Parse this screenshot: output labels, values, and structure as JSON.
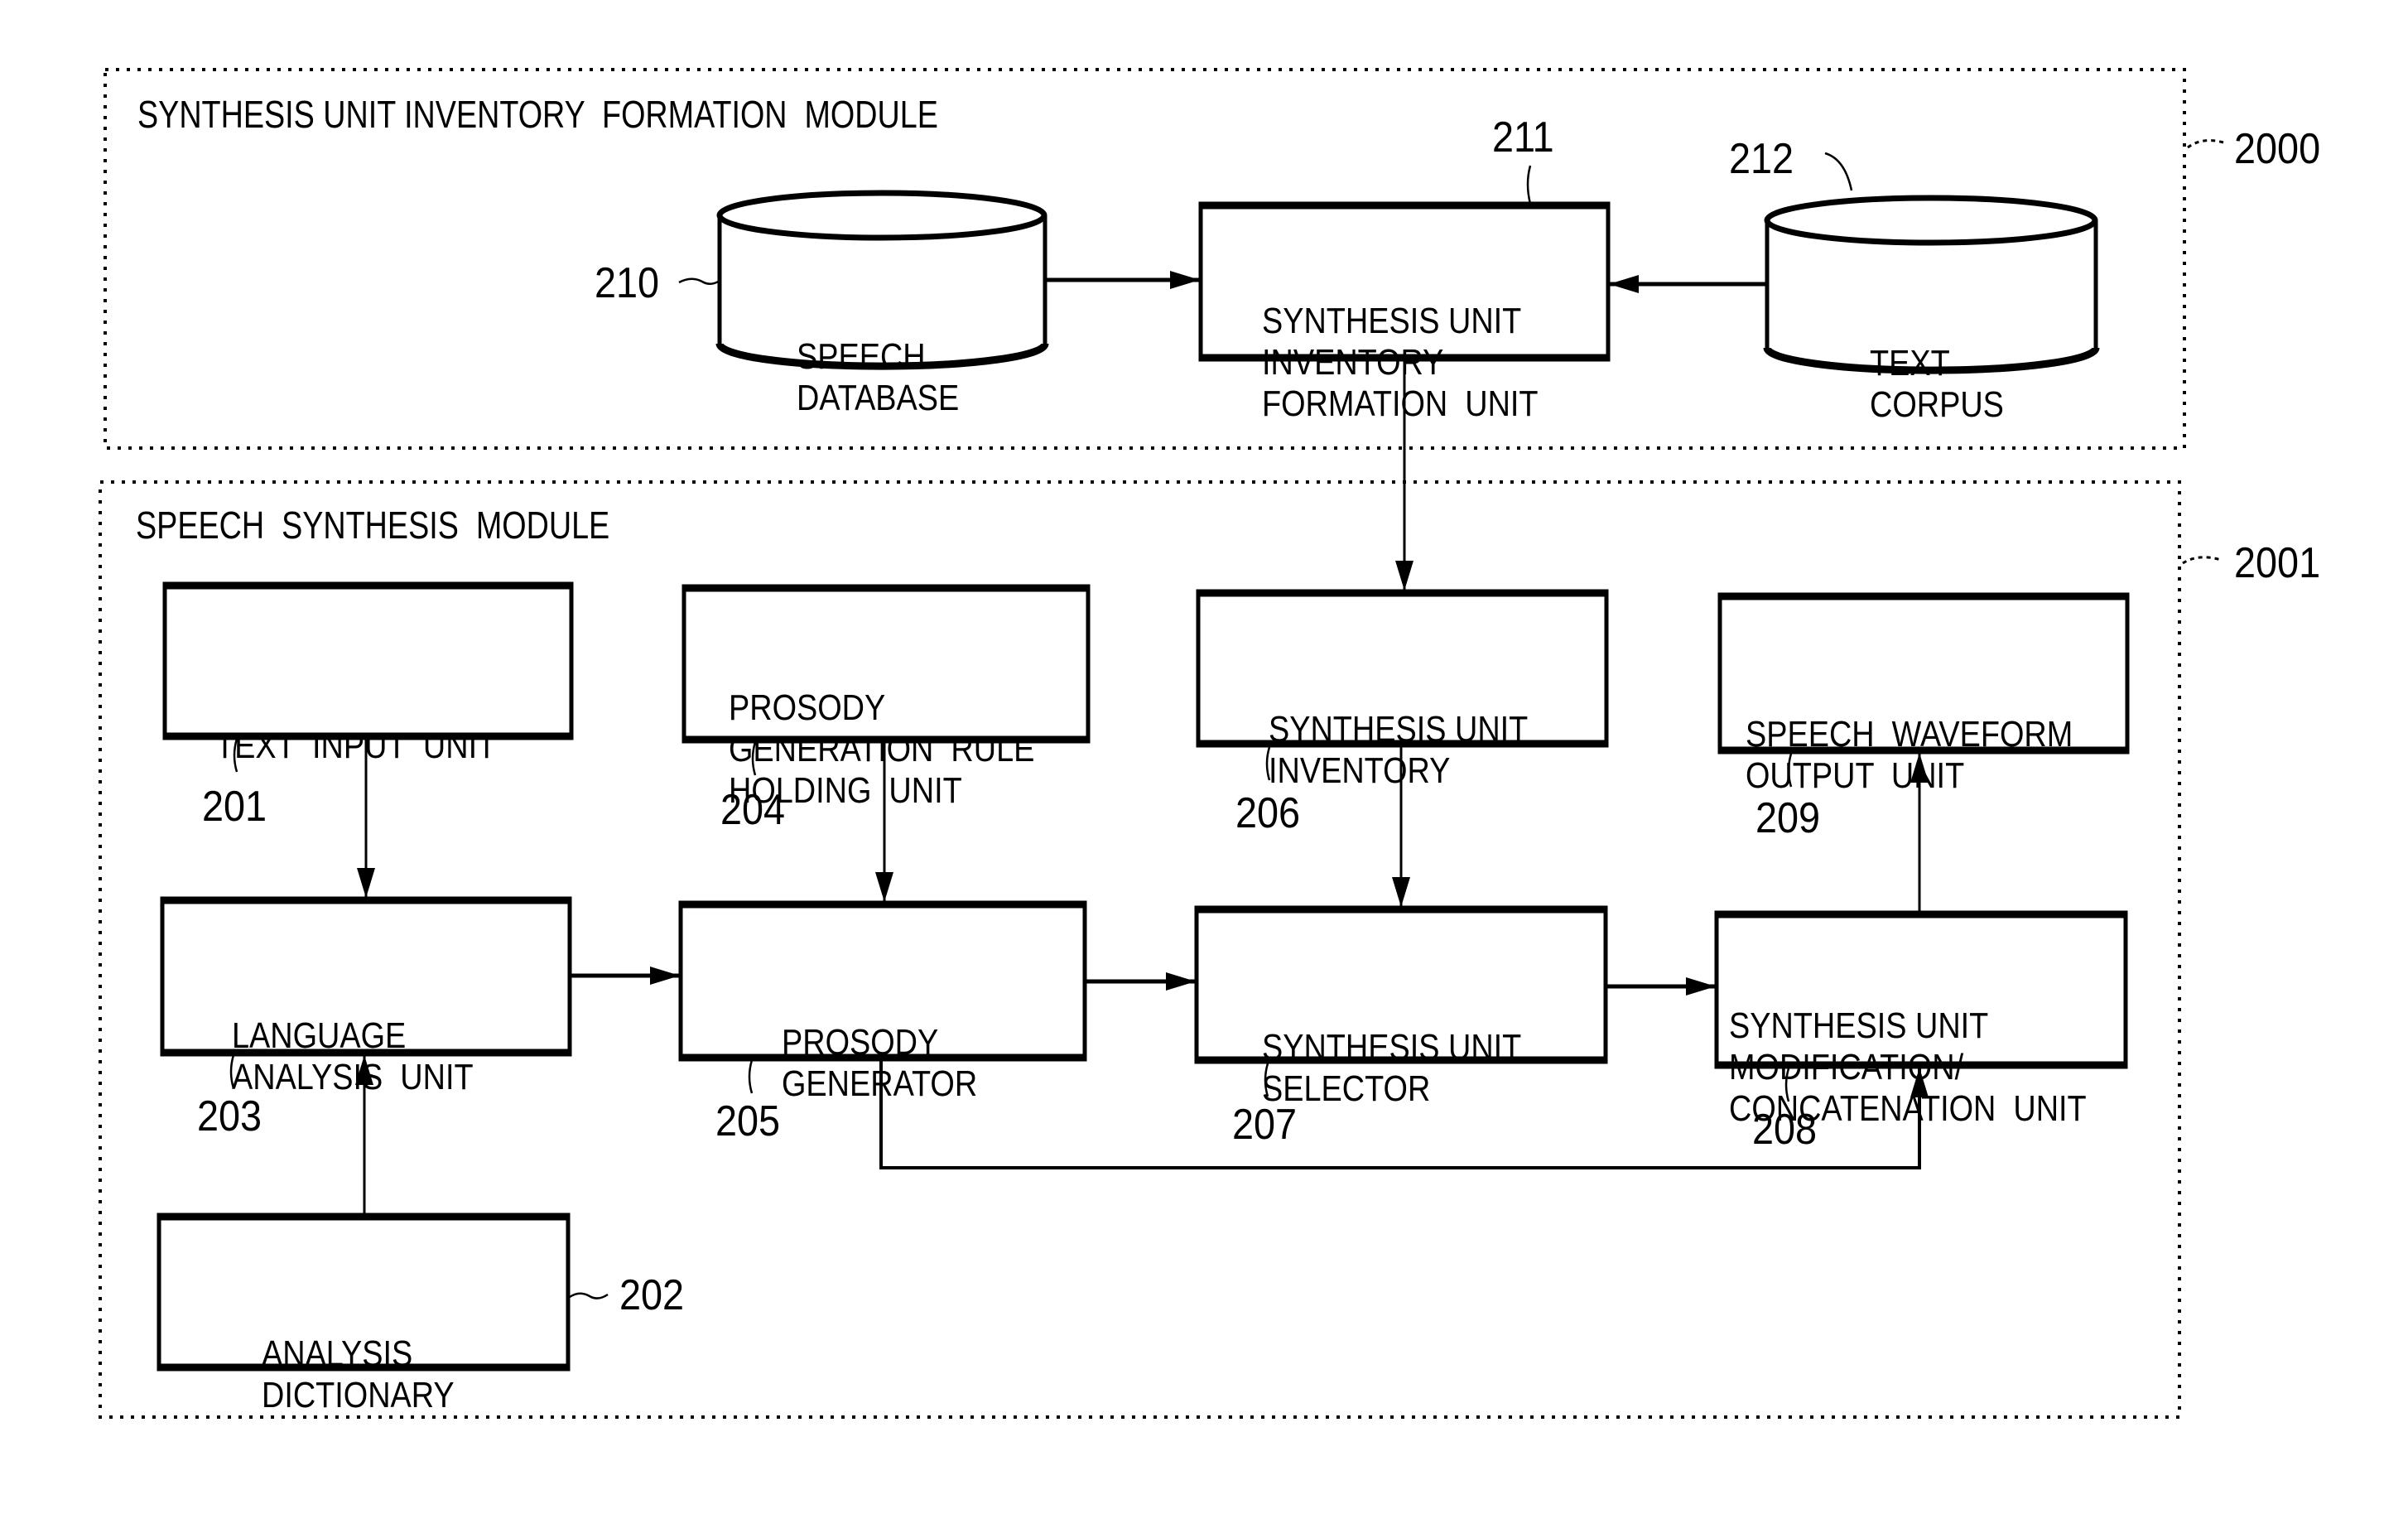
{
  "modules": {
    "inventory_formation": {
      "title": "SYNTHESIS UNIT INVENTORY  FORMATION  MODULE",
      "ref": "2000"
    },
    "speech_synthesis": {
      "title": "SPEECH  SYNTHESIS  MODULE",
      "ref": "2001"
    }
  },
  "blocks": {
    "speech_database": {
      "lines": [
        "SPEECH",
        "DATABASE"
      ],
      "ref": "210",
      "shape": "cylinder"
    },
    "inventory_formation_unit": {
      "lines": [
        "SYNTHESIS UNIT",
        "INVENTORY",
        "FORMATION  UNIT"
      ],
      "ref": "211",
      "shape": "box"
    },
    "text_corpus": {
      "lines": [
        "TEXT",
        "CORPUS"
      ],
      "ref": "212",
      "shape": "cylinder"
    },
    "text_input_unit": {
      "lines": [
        "TEXT  INPUT  UNIT"
      ],
      "ref": "201",
      "shape": "box"
    },
    "analysis_dictionary": {
      "lines": [
        "ANALYSIS",
        "DICTIONARY"
      ],
      "ref": "202",
      "shape": "box"
    },
    "language_analysis_unit": {
      "lines": [
        "LANGUAGE",
        "ANALYSIS  UNIT"
      ],
      "ref": "203",
      "shape": "box"
    },
    "prosody_rule_holding_unit": {
      "lines": [
        "PROSODY",
        "GENERATION  RULE",
        "HOLDING  UNIT"
      ],
      "ref": "204",
      "shape": "box"
    },
    "prosody_generator": {
      "lines": [
        "PROSODY",
        "GENERATOR"
      ],
      "ref": "205",
      "shape": "box"
    },
    "synthesis_unit_inventory": {
      "lines": [
        "SYNTHESIS UNIT",
        "INVENTORY"
      ],
      "ref": "206",
      "shape": "box"
    },
    "synthesis_unit_selector": {
      "lines": [
        "SYNTHESIS UNIT",
        "SELECTOR"
      ],
      "ref": "207",
      "shape": "box"
    },
    "modification_concatenation_unit": {
      "lines": [
        "SYNTHESIS UNIT",
        "MODIFICATION/",
        "CONCATENATION  UNIT"
      ],
      "ref": "208",
      "shape": "box"
    },
    "speech_waveform_output_unit": {
      "lines": [
        "SPEECH  WAVEFORM",
        "OUTPUT  UNIT"
      ],
      "ref": "209",
      "shape": "box"
    }
  },
  "connections": [
    {
      "from": "speech_database",
      "to": "inventory_formation_unit"
    },
    {
      "from": "text_corpus",
      "to": "inventory_formation_unit"
    },
    {
      "from": "inventory_formation_unit",
      "to": "synthesis_unit_inventory"
    },
    {
      "from": "text_input_unit",
      "to": "language_analysis_unit"
    },
    {
      "from": "analysis_dictionary",
      "to": "language_analysis_unit"
    },
    {
      "from": "language_analysis_unit",
      "to": "prosody_generator"
    },
    {
      "from": "prosody_rule_holding_unit",
      "to": "prosody_generator"
    },
    {
      "from": "prosody_generator",
      "to": "synthesis_unit_selector"
    },
    {
      "from": "synthesis_unit_inventory",
      "to": "synthesis_unit_selector"
    },
    {
      "from": "synthesis_unit_selector",
      "to": "modification_concatenation_unit"
    },
    {
      "from": "prosody_generator",
      "to": "modification_concatenation_unit"
    },
    {
      "from": "modification_concatenation_unit",
      "to": "speech_waveform_output_unit"
    }
  ]
}
